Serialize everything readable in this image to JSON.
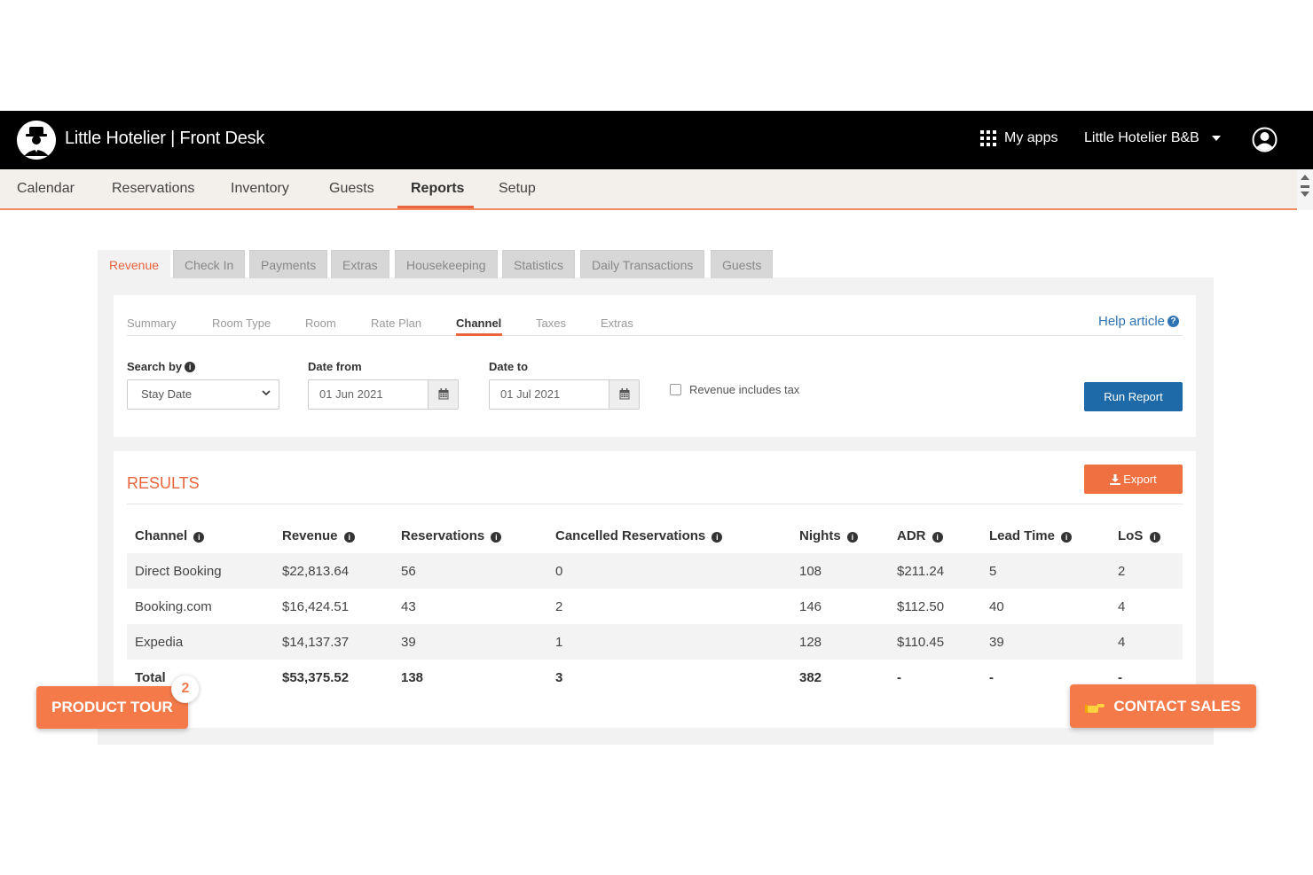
{
  "header": {
    "app_title": "Little Hotelier | Front Desk",
    "my_apps_label": "My apps",
    "property_name": "Little Hotelier B&B"
  },
  "nav": {
    "items": [
      "Calendar",
      "Reservations",
      "Inventory",
      "Guests",
      "Reports",
      "Setup"
    ],
    "active": "Reports"
  },
  "report_tabs": {
    "items": [
      "Revenue",
      "Check In",
      "Payments",
      "Extras",
      "Housekeeping",
      "Statistics",
      "Daily Transactions",
      "Guests"
    ],
    "active": "Revenue"
  },
  "sub_tabs": {
    "items": [
      "Summary",
      "Room Type",
      "Room",
      "Rate Plan",
      "Channel",
      "Taxes",
      "Extras"
    ],
    "active": "Channel"
  },
  "help_article_label": "Help article",
  "filters": {
    "search_by_label": "Search by",
    "search_by_value": "Stay Date",
    "date_from_label": "Date from",
    "date_from_value": "01 Jun 2021",
    "date_to_label": "Date to",
    "date_to_value": "01 Jul 2021",
    "tax_checkbox_label": "Revenue includes tax",
    "tax_checked": false,
    "run_report_label": "Run Report"
  },
  "results": {
    "title": "RESULTS",
    "export_label": "Export",
    "columns": [
      "Channel",
      "Revenue",
      "Reservations",
      "Cancelled Reservations",
      "Nights",
      "ADR",
      "Lead Time",
      "LoS"
    ],
    "rows": [
      [
        "Direct Booking",
        "$22,813.64",
        "56",
        "0",
        "108",
        "$211.24",
        "5",
        "2"
      ],
      [
        "Booking.com",
        "$16,424.51",
        "43",
        "2",
        "146",
        "$112.50",
        "40",
        "4"
      ],
      [
        "Expedia",
        "$14,137.37",
        "39",
        "1",
        "128",
        "$110.45",
        "39",
        "4"
      ]
    ],
    "total": [
      "Total",
      "$53,375.52",
      "138",
      "3",
      "382",
      "-",
      "-",
      "-"
    ]
  },
  "product_tour": {
    "label": "PRODUCT TOUR",
    "badge": "2"
  },
  "contact_sales_label": "CONTACT SALES",
  "colors": {
    "accent_orange": "#e8643c",
    "button_blue": "#1e6aa8",
    "header_black": "#000000"
  }
}
